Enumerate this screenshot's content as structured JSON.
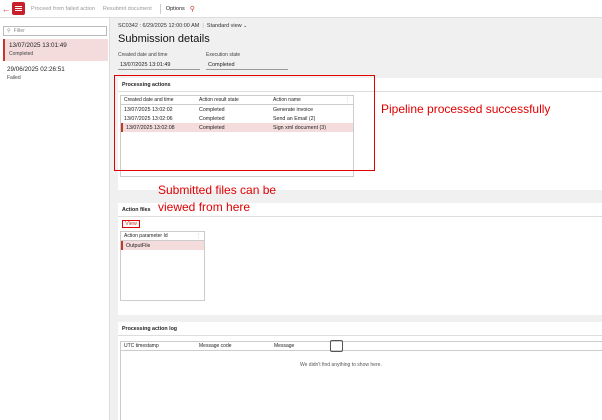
{
  "toolbar": {
    "back_icon": "back-arrow-icon",
    "app_icon": "document-list-icon",
    "items": [
      "Proceed from failed action",
      "Resubmit document"
    ],
    "options": "Options",
    "search_icon": "search-icon"
  },
  "list": {
    "filter_placeholder": "Filter",
    "records": [
      {
        "date": "13/07/2025 13:01:49",
        "status": "Completed"
      },
      {
        "date": "29/06/2025 02:26:51",
        "status": "Failed"
      }
    ]
  },
  "header": {
    "record_id": "SC0342 : 6/29/2025 12:00:00 AM",
    "view": "Standard view",
    "title": "Submission details"
  },
  "fields": {
    "created_label": "Created date and time",
    "created_value": "13/07/2025 13:01:49",
    "state_label": "Execution state",
    "state_value": "Completed"
  },
  "processing_actions": {
    "title": "Processing actions",
    "columns": [
      "Created date and time",
      "Action result state",
      "Action name"
    ],
    "rows": [
      [
        "13/07/2025 13:02:02",
        "Completed",
        "Generate invoice"
      ],
      [
        "13/07/2025 13:02:06",
        "Completed",
        "Send an Email (2)"
      ],
      [
        "13/07/2025 13:02:08",
        "Completed",
        "Sign xml document (3)"
      ]
    ]
  },
  "action_files": {
    "title": "Action files",
    "view_label": "View",
    "column": "Action parameter Id",
    "rows": [
      "OutputFile"
    ]
  },
  "processing_log": {
    "title": "Processing action log",
    "columns": [
      "UTC timestamp",
      "Message code",
      "Message"
    ],
    "empty_text": "We didn't find anything to show here."
  },
  "annotations": {
    "pipeline": "Pipeline processed successfully",
    "files_line1": "Submitted files can be",
    "files_line2": "viewed from here"
  },
  "colors": {
    "accent": "#c8202b",
    "annotation": "#e00000",
    "selected": "#f4dcdc"
  }
}
